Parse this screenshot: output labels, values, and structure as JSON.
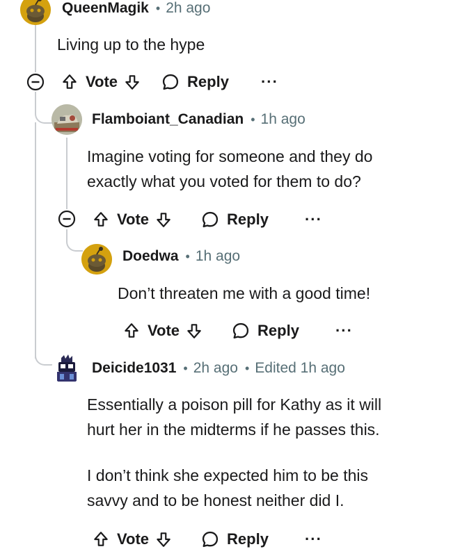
{
  "comments": [
    {
      "username": "QueenMagik",
      "time": "2h ago",
      "text": [
        "Living up to the hype"
      ],
      "vote_label": "Vote",
      "reply_label": "Reply",
      "more_label": "···"
    },
    {
      "username": "Flamboiant_Canadian",
      "time": "1h ago",
      "text": [
        "Imagine voting for someone and they do",
        "exactly what you voted for them to do?"
      ],
      "vote_label": "Vote",
      "reply_label": "Reply",
      "more_label": "···"
    },
    {
      "username": "Doedwa",
      "time": "1h ago",
      "text": [
        "Don’t threaten me with a good time!"
      ],
      "vote_label": "Vote",
      "reply_label": "Reply",
      "more_label": "···"
    },
    {
      "username": "Deicide1031",
      "time": "2h ago",
      "edited": "Edited 1h ago",
      "text": [
        "Essentially a poison pill for Kathy as it will",
        "hurt her in the midterms if he passes this.",
        "I don’t think she expected him to be this",
        "savvy and to be honest neither did I."
      ],
      "vote_label": "Vote",
      "reply_label": "Reply",
      "more_label": "···"
    }
  ],
  "colors": {
    "thread_line": "#c9ccd0",
    "text": "#1a1a1b",
    "muted": "#576f76",
    "snoo_avatar_bg": "#d4a10f"
  },
  "icons": [
    "upvote-icon",
    "downvote-icon",
    "reply-bubble-icon",
    "collapse-icon",
    "more-icon"
  ]
}
